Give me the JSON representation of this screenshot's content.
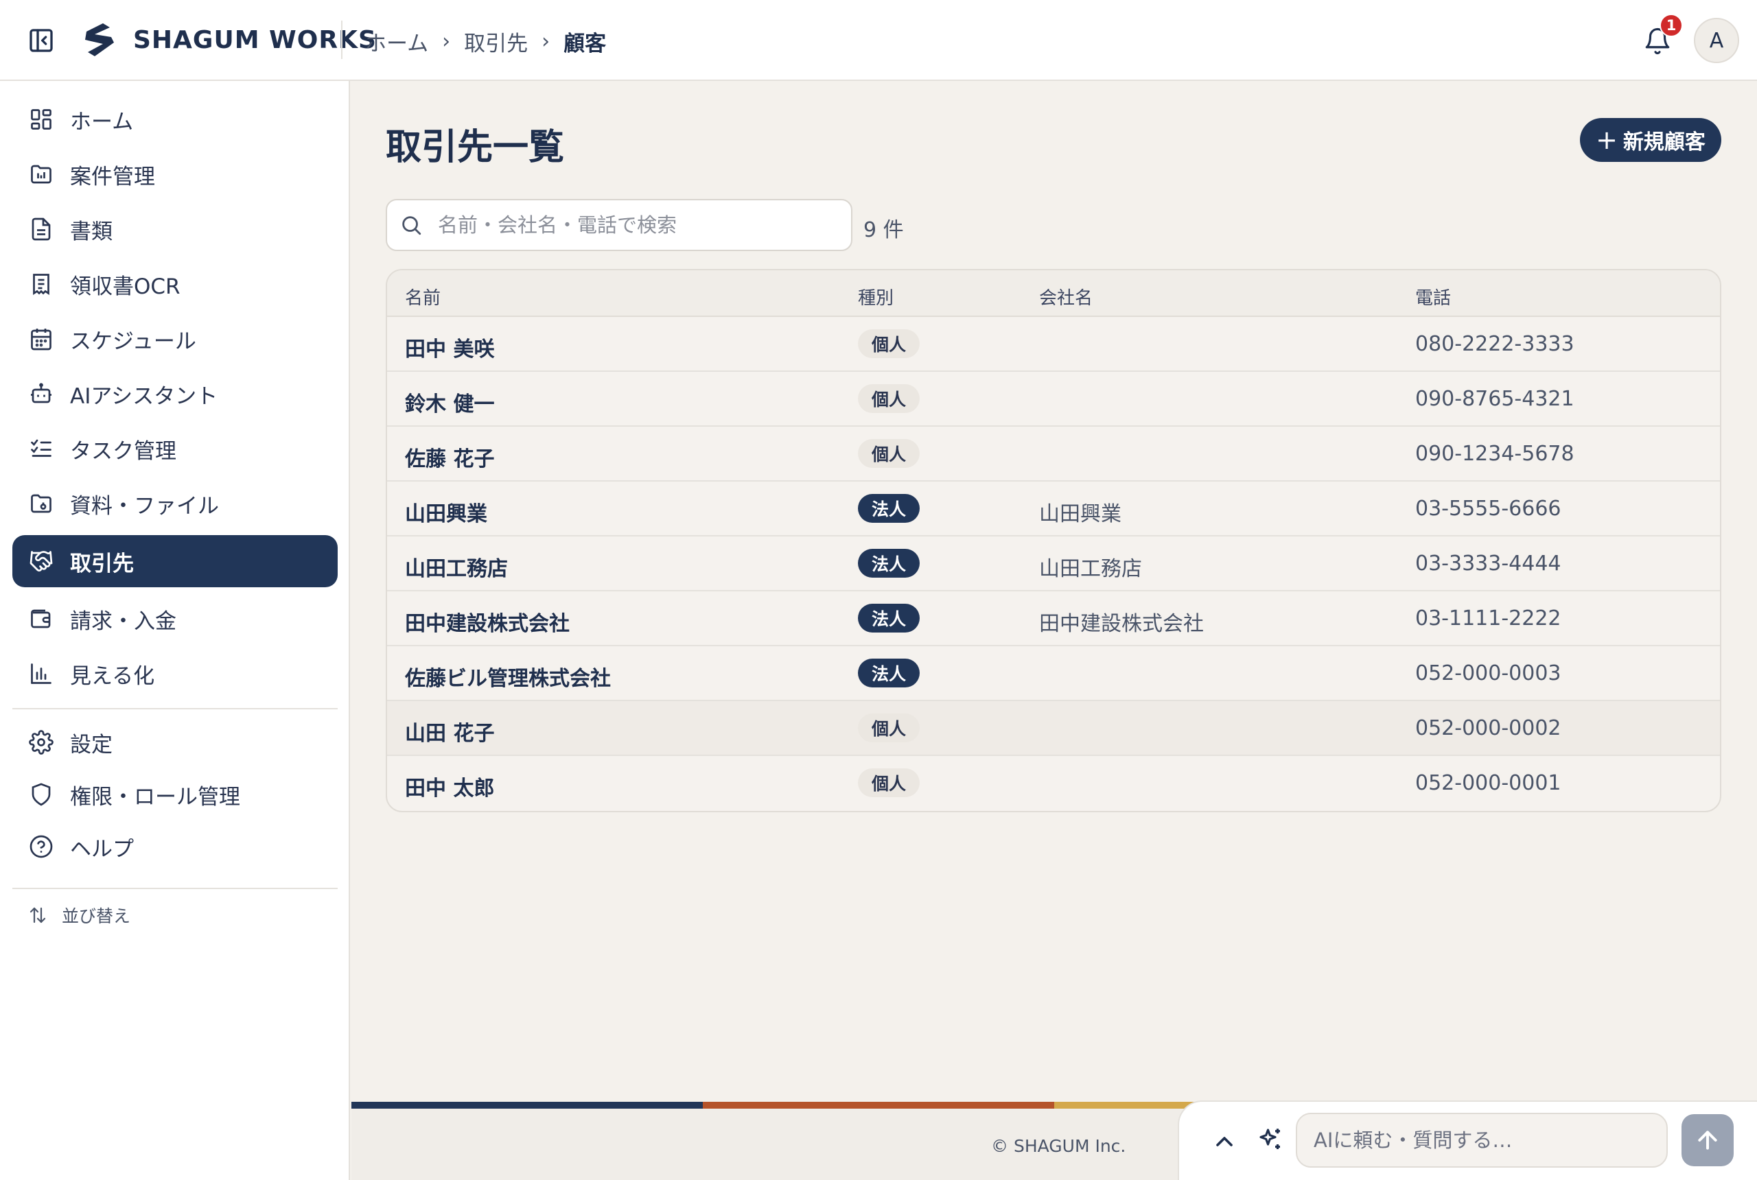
{
  "app": {
    "brand": "SHAGUM WORKS"
  },
  "breadcrumb": [
    "ホーム",
    "取引先",
    "顧客"
  ],
  "notifications": {
    "count": "1"
  },
  "user": {
    "avatar_initial": "A"
  },
  "sidebar": {
    "items": [
      {
        "label": "ホーム",
        "icon": "dashboard-icon"
      },
      {
        "label": "案件管理",
        "icon": "folder-chart-icon"
      },
      {
        "label": "書類",
        "icon": "document-icon"
      },
      {
        "label": "領収書OCR",
        "icon": "receipt-icon"
      },
      {
        "label": "スケジュール",
        "icon": "calendar-icon"
      },
      {
        "label": "AIアシスタント",
        "icon": "bot-icon"
      },
      {
        "label": "タスク管理",
        "icon": "checklist-icon"
      },
      {
        "label": "資料・ファイル",
        "icon": "folder-file-icon"
      },
      {
        "label": "取引先",
        "icon": "handshake-icon",
        "active": true
      },
      {
        "label": "請求・入金",
        "icon": "wallet-icon"
      },
      {
        "label": "見える化",
        "icon": "bar-chart-icon"
      }
    ],
    "secondary": [
      {
        "label": "設定",
        "icon": "gear-icon"
      },
      {
        "label": "権限・ロール管理",
        "icon": "shield-icon"
      },
      {
        "label": "ヘルプ",
        "icon": "help-icon"
      }
    ],
    "sort_label": "並び替え"
  },
  "main": {
    "title": "取引先一覧",
    "new_button": "新規顧客",
    "search_placeholder": "名前・会社名・電話で検索",
    "count": "9 件",
    "columns": [
      "名前",
      "種別",
      "会社名",
      "電話"
    ],
    "rows": [
      {
        "name": "田中 美咲",
        "type": "個人",
        "company": "",
        "phone": "080-2222-3333"
      },
      {
        "name": "鈴木 健一",
        "type": "個人",
        "company": "",
        "phone": "090-8765-4321"
      },
      {
        "name": "佐藤 花子",
        "type": "個人",
        "company": "",
        "phone": "090-1234-5678"
      },
      {
        "name": "山田興業",
        "type": "法人",
        "company": "山田興業",
        "phone": "03-5555-6666"
      },
      {
        "name": "山田工務店",
        "type": "法人",
        "company": "山田工務店",
        "phone": "03-3333-4444"
      },
      {
        "name": "田中建設株式会社",
        "type": "法人",
        "company": "田中建設株式会社",
        "phone": "03-1111-2222"
      },
      {
        "name": "佐藤ビル管理株式会社",
        "type": "法人",
        "company": "",
        "phone": "052-000-0003"
      },
      {
        "name": "山田 花子",
        "type": "個人",
        "company": "",
        "phone": "052-000-0002"
      },
      {
        "name": "田中 太郎",
        "type": "個人",
        "company": "",
        "phone": "052-000-0001"
      }
    ]
  },
  "footer": {
    "copyright": "© SHAGUM Inc."
  },
  "ai_bar": {
    "placeholder": "AIに頼む・質問する…"
  },
  "colors": {
    "primary": "#213658",
    "stripe": [
      "#213658",
      "#b5532a",
      "#d4a84b"
    ],
    "badge_alert": "#d02a2a"
  }
}
